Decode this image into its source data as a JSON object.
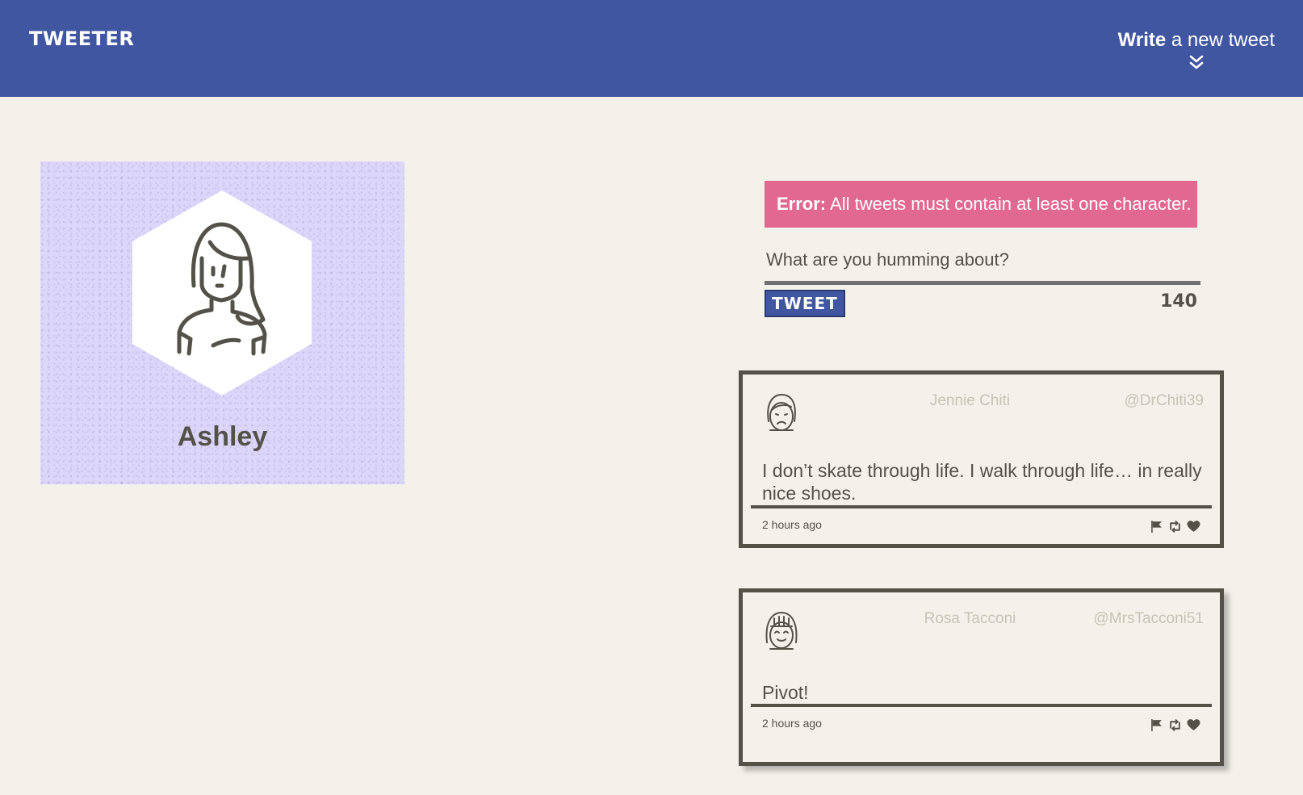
{
  "nav": {
    "logo": "TWEETER",
    "compose_bold": "Write",
    "compose_rest": " a new tweet",
    "chevron_icon": "double-chevron-down-icon",
    "background": "#4056a1"
  },
  "profile": {
    "name": "Ashley",
    "avatar_icon": "girl-avatar-icon",
    "background": "#ddd6fb"
  },
  "composer": {
    "error_label": "Error:",
    "error_message": " All tweets must contain at least one character.",
    "placeholder": "What are you humming about?",
    "value": "",
    "button_label": "TWEET",
    "counter": "140",
    "error_color": "#e06891"
  },
  "tweets": [
    {
      "avatar_icon": "sad-girl-avatar-icon",
      "name": "Jennie Chiti",
      "handle": "@DrChiti39",
      "body": "I don’t skate through life. I walk through life… in really nice shoes.",
      "time": "2 hours ago",
      "actions": [
        "flag-icon",
        "retweet-icon",
        "heart-icon"
      ]
    },
    {
      "avatar_icon": "happy-girl-avatar-icon",
      "name": "Rosa Tacconi",
      "handle": "@MrsTacconi51",
      "body": "Pivot!",
      "time": "2 hours ago",
      "actions": [
        "flag-icon",
        "retweet-icon",
        "heart-icon"
      ]
    }
  ]
}
